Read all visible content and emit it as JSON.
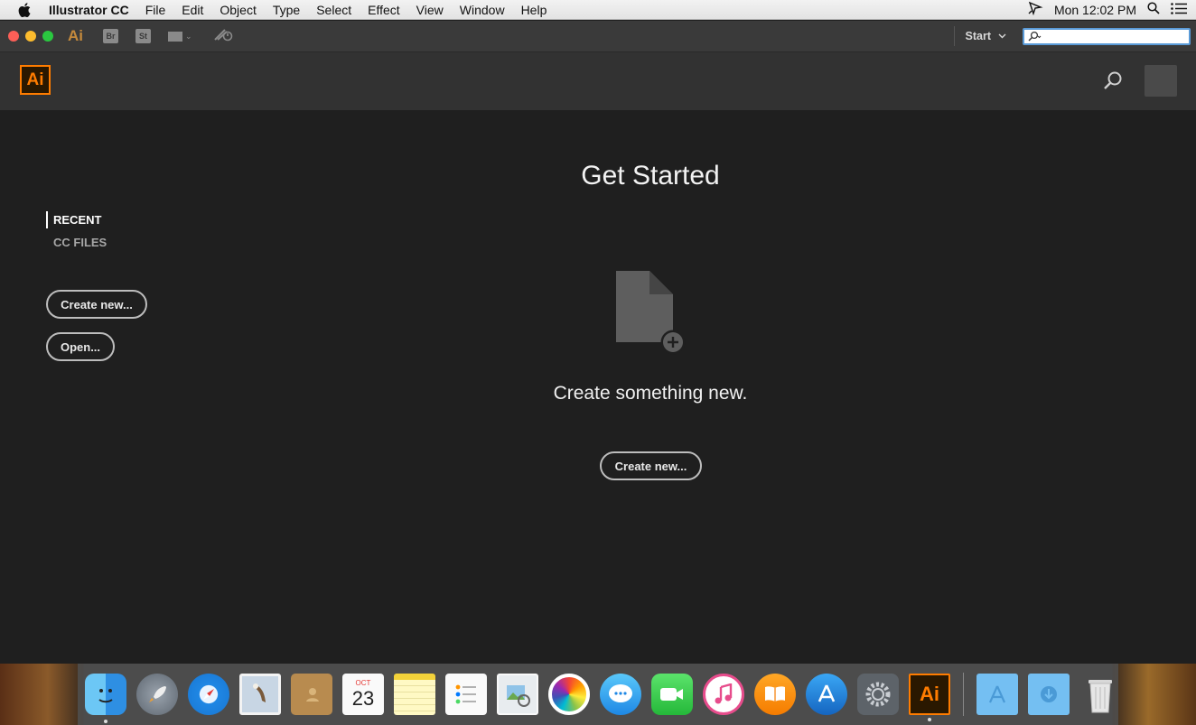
{
  "menubar": {
    "app_name": "Illustrator CC",
    "menus": [
      "File",
      "Edit",
      "Object",
      "Type",
      "Select",
      "Effect",
      "View",
      "Window",
      "Help"
    ],
    "clock": "Mon 12:02 PM"
  },
  "appbar": {
    "app_icon_text": "Ai",
    "bridge_label": "Br",
    "stock_label": "St",
    "workspace_label": "Start",
    "search_placeholder": ""
  },
  "header": {
    "logo_text": "Ai"
  },
  "left_nav": {
    "items": [
      {
        "label": "RECENT",
        "active": true
      },
      {
        "label": "CC FILES",
        "active": false
      }
    ],
    "create_new_label": "Create new...",
    "open_label": "Open..."
  },
  "main": {
    "title": "Get Started",
    "subtitle": "Create something new.",
    "create_new_label": "Create new..."
  },
  "dock": {
    "calendar_month": "OCT",
    "calendar_day": "23",
    "illustrator_label": "Ai",
    "apps": [
      "finder",
      "launchpad",
      "safari",
      "mail",
      "contacts",
      "calendar",
      "notes",
      "reminders",
      "preview",
      "photos",
      "messages",
      "facetime",
      "itunes",
      "ibooks",
      "app-store",
      "system-preferences",
      "illustrator",
      "applications-folder",
      "downloads-folder",
      "trash"
    ]
  },
  "colors": {
    "accent": "#ff7c00",
    "background": "#1f1f1f",
    "header": "#323232"
  }
}
